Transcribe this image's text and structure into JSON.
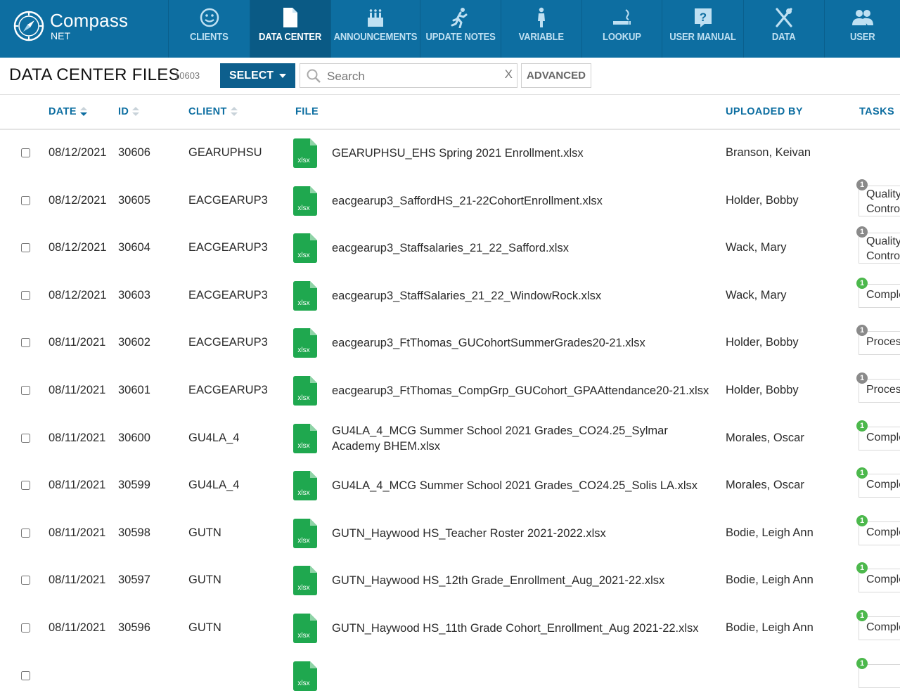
{
  "brand": {
    "name": "Compass",
    "sub": "NET"
  },
  "nav": [
    {
      "label": "CLIENTS",
      "icon": "smiley-icon"
    },
    {
      "label": "DATA CENTER",
      "icon": "document-icon",
      "active": true
    },
    {
      "label": "ANNOUNCEMENTS",
      "icon": "cake-icon"
    },
    {
      "label": "UPDATE NOTES",
      "icon": "runner-icon"
    },
    {
      "label": "VARIABLE",
      "icon": "person-icon"
    },
    {
      "label": "LOOKUP",
      "icon": "smoking-icon"
    },
    {
      "label": "USER MANUAL",
      "icon": "help-icon"
    },
    {
      "label": "DATA",
      "icon": "utensils-icon"
    },
    {
      "label": "USER",
      "icon": "users-icon"
    }
  ],
  "toolbar": {
    "title": "DATA CENTER FILES",
    "count": "10603",
    "select_label": "SELECT",
    "search_placeholder": "Search",
    "clear_label": "X",
    "advanced_label": "ADVANCED"
  },
  "columns": {
    "date": "DATE",
    "id": "ID",
    "client": "CLIENT",
    "file": "FILE",
    "uploaded_by": "UPLOADED BY",
    "tasks": "TASKS"
  },
  "file_icon_label": "xlsx",
  "colors": {
    "nav_bg": "#0d6ea1",
    "nav_active": "#0a5a85",
    "excel_green": "#1fa84f",
    "badge_gray": "#8a8a8a",
    "badge_green": "#4cb84c"
  },
  "rows": [
    {
      "date": "08/12/2021",
      "id": "30606",
      "client": "GEARUPHSU",
      "file": "GEARUPHSU_EHS Spring 2021 Enrollment.xlsx",
      "uploaded_by": "Branson, Keivan",
      "task": null
    },
    {
      "date": "08/12/2021",
      "id": "30605",
      "client": "EACGEARUP3",
      "file": "eacgearup3_SaffordHS_21-22CohortEnrollment.xlsx",
      "uploaded_by": "Holder, Bobby",
      "task": {
        "label": "Quality Control",
        "badge": "1",
        "status": "gray"
      }
    },
    {
      "date": "08/12/2021",
      "id": "30604",
      "client": "EACGEARUP3",
      "file": "eacgearup3_Staffsalaries_21_22_Safford.xlsx",
      "uploaded_by": "Wack, Mary",
      "task": {
        "label": "Quality Control",
        "badge": "1",
        "status": "gray"
      }
    },
    {
      "date": "08/12/2021",
      "id": "30603",
      "client": "EACGEARUP3",
      "file": "eacgearup3_StaffSalaries_21_22_WindowRock.xlsx",
      "uploaded_by": "Wack, Mary",
      "task": {
        "label": "Complete",
        "badge": "1",
        "status": "green"
      }
    },
    {
      "date": "08/11/2021",
      "id": "30602",
      "client": "EACGEARUP3",
      "file": "eacgearup3_FtThomas_GUCohortSummerGrades20-21.xlsx",
      "uploaded_by": "Holder, Bobby",
      "task": {
        "label": "Processing",
        "badge": "1",
        "status": "gray"
      }
    },
    {
      "date": "08/11/2021",
      "id": "30601",
      "client": "EACGEARUP3",
      "file": "eacgearup3_FtThomas_CompGrp_GUCohort_GPAAttendance20-21.xlsx",
      "uploaded_by": "Holder, Bobby",
      "task": {
        "label": "Processing",
        "badge": "1",
        "status": "gray"
      }
    },
    {
      "date": "08/11/2021",
      "id": "30600",
      "client": "GU4LA_4",
      "file": "GU4LA_4_MCG Summer School 2021 Grades_CO24.25_Sylmar Academy BHEM.xlsx",
      "uploaded_by": "Morales, Oscar",
      "task": {
        "label": "Complete",
        "badge": "1",
        "status": "green"
      }
    },
    {
      "date": "08/11/2021",
      "id": "30599",
      "client": "GU4LA_4",
      "file": "GU4LA_4_MCG Summer School 2021 Grades_CO24.25_Solis LA.xlsx",
      "uploaded_by": "Morales, Oscar",
      "task": {
        "label": "Complete",
        "badge": "1",
        "status": "green"
      }
    },
    {
      "date": "08/11/2021",
      "id": "30598",
      "client": "GUTN",
      "file": "GUTN_Haywood HS_Teacher Roster 2021-2022.xlsx",
      "uploaded_by": "Bodie, Leigh Ann",
      "task": {
        "label": "Complete",
        "badge": "1",
        "status": "green"
      }
    },
    {
      "date": "08/11/2021",
      "id": "30597",
      "client": "GUTN",
      "file": "GUTN_Haywood HS_12th Grade_Enrollment_Aug_2021-22.xlsx",
      "uploaded_by": "Bodie, Leigh Ann",
      "task": {
        "label": "Complete",
        "badge": "1",
        "status": "green"
      }
    },
    {
      "date": "08/11/2021",
      "id": "30596",
      "client": "GUTN",
      "file": "GUTN_Haywood HS_11th Grade Cohort_Enrollment_Aug 2021-22.xlsx",
      "uploaded_by": "Bodie, Leigh Ann",
      "task": {
        "label": "Complete",
        "badge": "1",
        "status": "green"
      }
    },
    {
      "date": "",
      "id": "",
      "client": "",
      "file": "",
      "uploaded_by": "",
      "task": {
        "label": "",
        "badge": "1",
        "status": "green"
      }
    }
  ]
}
